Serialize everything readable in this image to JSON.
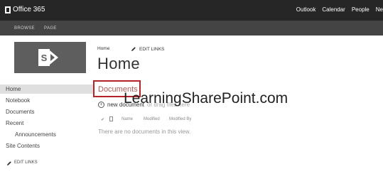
{
  "suite_bar": {
    "brand": "Office 365",
    "links": [
      "Outlook",
      "Calendar",
      "People",
      "Ne"
    ]
  },
  "ribbon": {
    "tabs": [
      "BROWSE",
      "PAGE"
    ]
  },
  "logo": {
    "letter": "S"
  },
  "left_nav": {
    "items": [
      "Home",
      "Notebook",
      "Documents",
      "Recent",
      "Announcements",
      "Site Contents"
    ],
    "edit_links": "EDIT LINKS",
    "selected": "Home"
  },
  "breadcrumb": {
    "home": "Home",
    "edit_links": "EDIT LINKS"
  },
  "page": {
    "title": "Home"
  },
  "documents_webpart": {
    "title": "Documents",
    "new_document": "new document",
    "new_document_suffix": "or drag files here",
    "columns": [
      "Name",
      "Modified",
      "Modified By"
    ],
    "empty_message": "There are no documents in this view."
  },
  "watermark": {
    "text": "LearningSharePoint.com"
  },
  "colors": {
    "suite_bar": "#262626",
    "ribbon": "#444444",
    "highlight": "#b4232a",
    "logo_bg": "#5e5e5e"
  }
}
